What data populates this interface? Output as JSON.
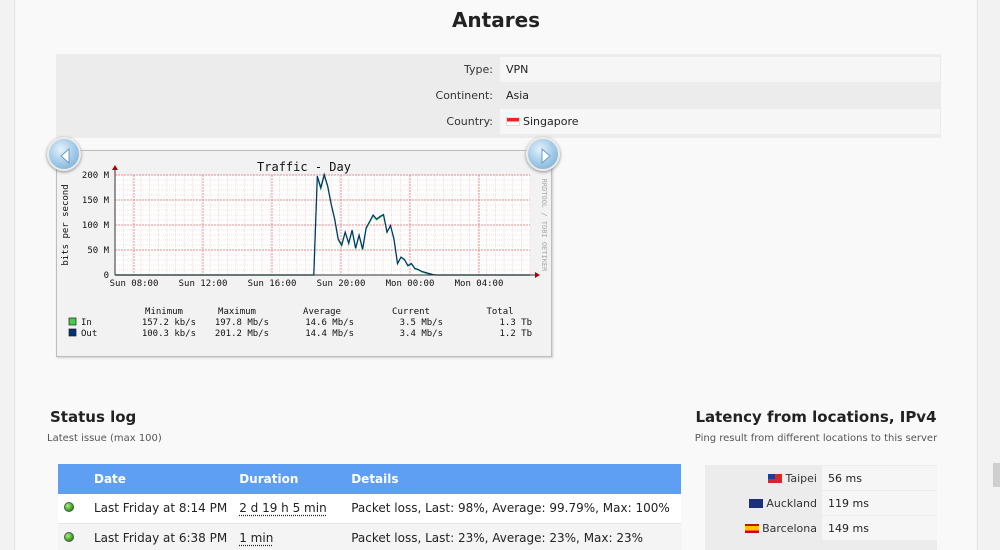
{
  "page": {
    "title": "Antares"
  },
  "server_info": [
    {
      "label": "Type:",
      "value": "VPN"
    },
    {
      "label": "Continent:",
      "value": "Asia"
    },
    {
      "label": "Country:",
      "value": "Singapore",
      "flag": "sg-flag-icon"
    }
  ],
  "graph": {
    "nav_prev": "chevron-left-icon",
    "nav_next": "chevron-right-icon",
    "chart_data": {
      "type": "line",
      "title": "Traffic - Day",
      "ylabel": "bits per second",
      "side_label": "RRDTOOL / TOBI OETIKER",
      "y_ticks": [
        "0",
        "50 M",
        "100 M",
        "150 M",
        "200 M"
      ],
      "ylim": [
        0,
        200
      ],
      "x_ticks": [
        "Sun 08:00",
        "Sun 12:00",
        "Sun 16:00",
        "Sun 20:00",
        "Mon 00:00",
        "Mon 04:00"
      ],
      "grid": true,
      "series": [
        {
          "name": "In",
          "color": "#44cc44",
          "values": [
            0,
            0,
            0,
            0,
            0,
            0,
            0,
            0,
            0,
            0,
            0,
            0,
            0,
            0,
            0,
            0,
            0,
            0,
            0,
            0,
            0,
            0,
            0,
            0,
            0,
            0,
            0,
            0,
            0,
            0,
            0,
            0,
            0,
            0,
            0,
            0,
            0,
            0,
            0,
            0,
            0,
            0,
            0,
            0,
            0,
            0,
            0,
            0,
            0,
            0,
            0,
            0,
            0,
            0,
            0,
            0,
            0,
            0,
            195,
            172,
            198,
            176,
            140,
            110,
            70,
            58,
            85,
            62,
            88,
            52,
            78,
            50,
            92,
            105,
            118,
            110,
            115,
            120,
            85,
            98,
            70,
            22,
            35,
            30,
            18,
            22,
            12,
            10,
            6,
            4,
            2,
            1,
            0,
            0,
            0,
            0,
            0,
            0,
            0,
            0,
            0,
            0,
            0,
            0,
            0,
            0,
            0,
            0,
            0,
            0,
            0,
            0,
            0,
            0,
            0,
            0,
            0,
            0,
            0,
            0
          ]
        },
        {
          "name": "Out",
          "color": "#003377",
          "values": [
            0,
            0,
            0,
            0,
            0,
            0,
            0,
            0,
            0,
            0,
            0,
            0,
            0,
            0,
            0,
            0,
            0,
            0,
            0,
            0,
            0,
            0,
            0,
            0,
            0,
            0,
            0,
            0,
            0,
            0,
            0,
            0,
            0,
            0,
            0,
            0,
            0,
            0,
            0,
            0,
            0,
            0,
            0,
            0,
            0,
            0,
            0,
            0,
            0,
            0,
            0,
            0,
            0,
            0,
            0,
            0,
            0,
            0,
            198,
            175,
            201,
            178,
            142,
            112,
            72,
            60,
            86,
            64,
            90,
            54,
            80,
            52,
            94,
            107,
            120,
            112,
            117,
            121,
            86,
            99,
            72,
            23,
            36,
            31,
            19,
            23,
            13,
            11,
            7,
            5,
            3,
            1,
            0,
            0,
            0,
            0,
            0,
            0,
            0,
            0,
            0,
            0,
            0,
            0,
            0,
            0,
            0,
            0,
            0,
            0,
            0,
            0,
            0,
            0,
            0,
            0,
            0,
            0,
            0,
            0
          ]
        }
      ],
      "legend_headers": [
        "Minimum",
        "Maximum",
        "Average",
        "Current",
        "Total"
      ],
      "legend_rows": [
        {
          "name": "In",
          "color": "#44cc44",
          "cells": [
            "157.2 kb/s",
            "197.8 Mb/s",
            "14.6 Mb/s",
            "3.5 Mb/s",
            "1.3 Tb"
          ]
        },
        {
          "name": "Out",
          "color": "#003377",
          "cells": [
            "100.3 kb/s",
            "201.2 Mb/s",
            "14.4 Mb/s",
            "3.4 Mb/s",
            "1.2 Tb"
          ]
        }
      ]
    }
  },
  "status_log": {
    "title": "Status log",
    "subtitle": "Latest issue (max 100)",
    "columns": [
      "",
      "Date",
      "Duration",
      "Details"
    ],
    "rows": [
      {
        "status_icon": "green-status-dot-icon",
        "date": "Last Friday at 8:14 PM",
        "duration": "2 d 19 h 5 min",
        "details": "Packet loss, Last: 98%, Average: 99.79%, Max: 100%"
      },
      {
        "status_icon": "green-status-dot-icon",
        "date": "Last Friday at 6:38 PM",
        "duration": "1 min",
        "details": "Packet loss, Last: 23%, Average: 23%, Max: 23%"
      }
    ]
  },
  "latency": {
    "title": "Latency from locations, IPv4",
    "subtitle": "Ping result from different locations to this server",
    "rows": [
      {
        "location": "Taipei",
        "flag": "tw-flag-icon",
        "ms": "56 ms"
      },
      {
        "location": "Auckland",
        "flag": "nz-flag-icon",
        "ms": "119 ms"
      },
      {
        "location": "Barcelona",
        "flag": "es-flag-icon",
        "ms": "149 ms"
      }
    ]
  }
}
